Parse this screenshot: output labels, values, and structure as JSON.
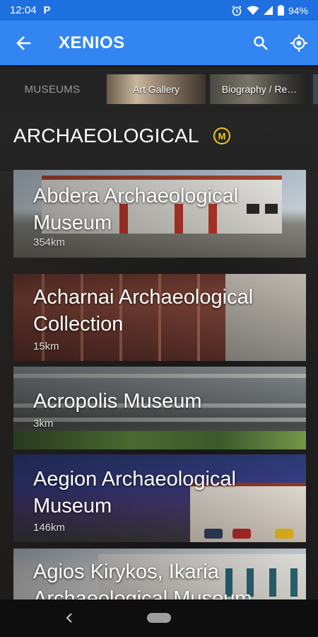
{
  "status_bar": {
    "time": "12:04",
    "notification": "P",
    "battery": "94%"
  },
  "app_bar": {
    "title": "XENIOS"
  },
  "tabs": [
    {
      "label": "MUSEUMS"
    },
    {
      "label": "Art Gallery"
    },
    {
      "label": "Biography / Re…"
    }
  ],
  "section": {
    "title": "ARCHAEOLOGICAL",
    "badge": "M"
  },
  "museums": [
    {
      "name": "Abdera Archaeological Museum",
      "distance": "354km"
    },
    {
      "name": "Acharnai Archaeological Collection",
      "distance": "15km"
    },
    {
      "name": "Acropolis Museum",
      "distance": "3km"
    },
    {
      "name": "Aegion Archaeological Museum",
      "distance": "146km"
    },
    {
      "name": "Agios Kirykos, Ikaria Archaeological Museum",
      "distance": ""
    }
  ],
  "colors": {
    "app_bar": "#3385f2",
    "status_bar": "#1e6fe0",
    "metro_badge": "#f2cc14"
  }
}
